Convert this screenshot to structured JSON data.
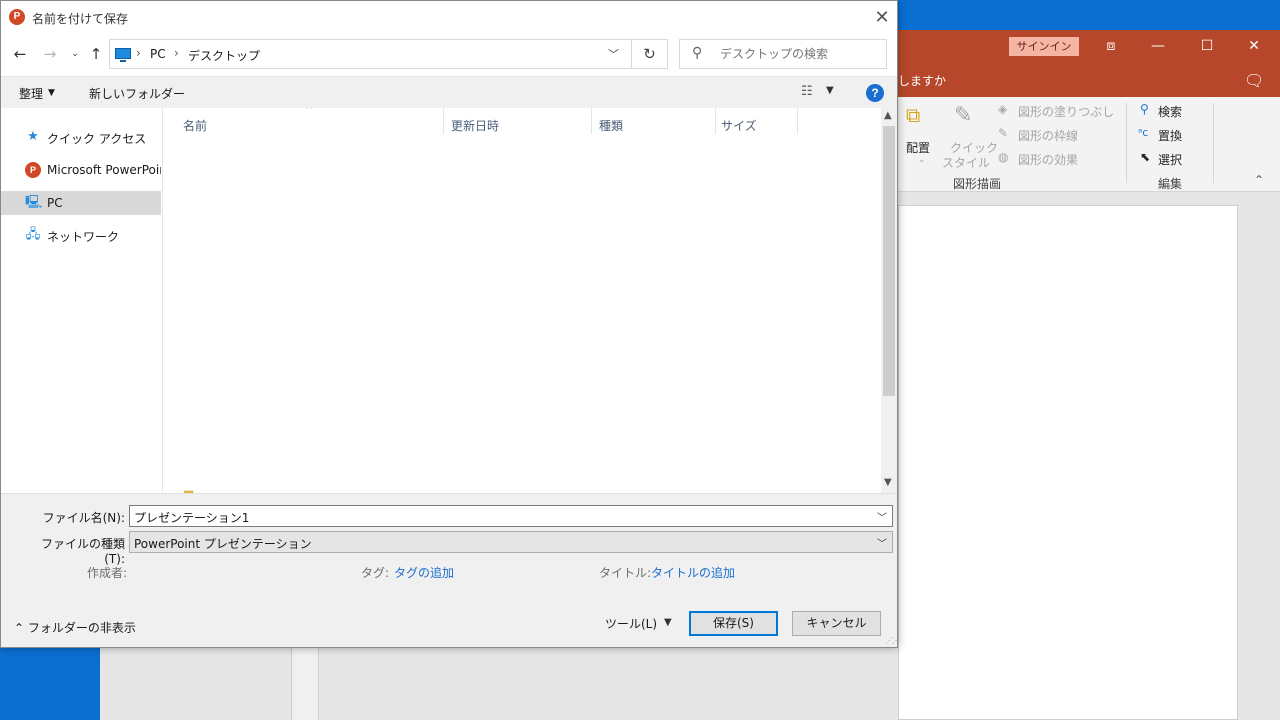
{
  "colors": {
    "ppt_red": "#b7472a",
    "link_blue": "#1a6fd1",
    "desktop_blue": "#0a6fd0"
  },
  "powerpoint": {
    "signin": "サインイン",
    "tell_me": "しますか",
    "ribbon": {
      "arrange": "配置",
      "quick_styles": "クイック",
      "quick_styles2": "スタイル",
      "shape_fill": "図形の塗りつぶし",
      "shape_outline": "図形の枠線",
      "shape_effects": "図形の効果",
      "group_drawing": "図形描画",
      "find": "検索",
      "replace": "置換",
      "select": "選択",
      "group_editing": "編集"
    }
  },
  "dialog": {
    "title": "名前を付けて保存",
    "address": {
      "crumb1": "PC",
      "crumb2": "デスクトップ"
    },
    "search_placeholder": "デスクトップの検索",
    "commands": {
      "organize": "整理",
      "new_folder": "新しいフォルダー"
    },
    "nav": [
      {
        "label": "クイック アクセス",
        "icon": "star-icon"
      },
      {
        "label": "Microsoft PowerPoin",
        "icon": "powerpoint-icon"
      },
      {
        "label": "PC",
        "icon": "pc-icon"
      },
      {
        "label": "ネットワーク",
        "icon": "network-icon"
      }
    ],
    "columns": {
      "name": "名前",
      "date": "更新日時",
      "type": "種類",
      "size": "サイズ"
    },
    "filename_label": "ファイル名(N):",
    "filename_value": "プレゼンテーション1",
    "filetype_label": "ファイルの種類(T):",
    "filetype_value": "PowerPoint プレゼンテーション",
    "meta": {
      "author_label": "作成者:",
      "tags_label": "タグ:",
      "tags_link": "タグの追加",
      "title_label": "タイトル:",
      "title_link": "タイトルの追加"
    },
    "hide_folders": "フォルダーの非表示",
    "tools": "ツール(L)",
    "save": "保存(S)",
    "cancel": "キャンセル"
  }
}
